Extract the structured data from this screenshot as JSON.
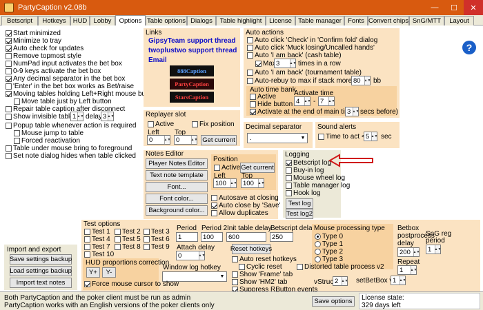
{
  "window": {
    "title": "PartyCaption v2.08b",
    "controls": {
      "minimize": "—",
      "maximize": "☐",
      "close": "✕"
    }
  },
  "tabs": [
    "Betscript",
    "Hotkeys",
    "HUD",
    "Lobby",
    "Options",
    "Table options",
    "Dialogs",
    "Table highlight",
    "License",
    "Table manager",
    "Fonts",
    "Convert chips",
    "SnG/MTT",
    "Layout"
  ],
  "general": {
    "start_minimized": "Start minimized",
    "minimize_tray": "Minimize to tray",
    "auto_check": "Auto check for updates",
    "remove_topmost": "Remove topmost style",
    "numpad": "NumPad input activates the bet box",
    "keys09": "0-9 keys activate the bet box",
    "decimal": "Any decimal separator in the bet box",
    "enter": "'Enter' in the bet box works as Bet/raise",
    "moving": "Moving tables holding Left+Right mouse buttons",
    "move_left": "Move table just by Left button",
    "repair": "Repair table caption after disconnect",
    "show_invisible": "Show invisible tables v",
    "show_invisible_val": "1",
    "delay_lbl": "delay",
    "delay_val": "3",
    "popup": "Popup table whenever action is required",
    "mouse_jump": "Mouse jump to table",
    "forced": "Forced reactivation",
    "under_mouse": "Table under mouse bring to foreground",
    "set_note": "Set note dialog hides when table clicked"
  },
  "links": {
    "title": "Links",
    "gipsy": "GipsyTeam support thread",
    "twoplus": "twoplustwo support thread",
    "email": "Email",
    "btn888": "888Caption",
    "btnparty": "PartyCaption",
    "btnstars": "StarsCaption"
  },
  "replayer": {
    "title": "Replayer slot",
    "active": "Active",
    "fix": "Fix position",
    "left": "Left",
    "top": "Top",
    "left_val": "0",
    "top_val": "0",
    "get": "Get current"
  },
  "auto": {
    "title": "Auto actions",
    "check": "Auto click 'Check' in 'Confirm fold' dialog",
    "muck": "Auto click 'Muck losing/Uncalled hands'",
    "back_cash": "Auto 'I am back' (cash table)",
    "max": "Max",
    "max_val": "3",
    "times": "times in a row",
    "back_tourn": "Auto 'I am back' (tournament table)",
    "rebuy": "Auto-rebuy to max if stack more than",
    "rebuy_val": "80",
    "bb": "bb"
  },
  "timebank": {
    "title": "Auto time bank",
    "active": "Active",
    "hide": "Hide button",
    "act_end": "Activate at the end of main time (",
    "act_end_val": "3",
    "secs": "secs before)",
    "act_time": "Activate time",
    "from": "4",
    "dash": "-",
    "to": "7"
  },
  "decimal": {
    "title": "Decimal separator",
    "value": "."
  },
  "sound": {
    "title": "Sound alerts",
    "time_to_act": "Time to act <",
    "val": "5",
    "sec": "sec"
  },
  "notes": {
    "title": "Notes Editor",
    "player_notes": "Player Notes Editor",
    "text_template": "Text note template",
    "font": "Font...",
    "font_color": "Font color...",
    "bg_color": "Background color..."
  },
  "position": {
    "title": "Position",
    "active": "Active",
    "get": "Get current",
    "left": "Left",
    "top": "Top",
    "left_val": "100",
    "top_val": "100",
    "autosave": "Autosave at closing",
    "autoclose": "Auto close by 'Save'",
    "allow_dup": "Allow duplicates"
  },
  "logging": {
    "title": "Logging",
    "betscript": "Betscript log",
    "buyin": "Buy-in log",
    "mousewheel": "Mouse wheel log",
    "tablemgr": "Table manager log",
    "hook": "Hook log",
    "btn_log": "Test log",
    "btn_log2": "Test log2"
  },
  "test": {
    "title": "Test options",
    "items": [
      "Test 1",
      "Test 2",
      "Test 3",
      "Test 4",
      "Test 5",
      "Test 6",
      "Test 7",
      "Test 8",
      "Test 9",
      "Test 10"
    ],
    "period": "Period",
    "period_val": "1",
    "period2": "Period 2",
    "period2_val": "100",
    "init_delay": "Init table delay",
    "init_delay_val": "600",
    "betscript_delay": "Betscript delay",
    "betscript_delay_val": "250",
    "attach": "Attach delay",
    "attach_val": "0",
    "reset_hotkeys": "Reset hotkeys",
    "auto_reset": "Auto reset hotkeys",
    "cyclic": "Cyclic reset",
    "show_frame": "Show 'Frame' tab",
    "show_hm2": "Show 'HM2' tab",
    "suppress": "Suppress RButton events",
    "window_hotkey": "Window log hotkey",
    "window_hotkey_val": ""
  },
  "mouse": {
    "title": "Mouse processing type",
    "types": [
      "Type 0",
      "Type 1",
      "Type 2",
      "Type 3"
    ],
    "distorted": "Distorted table process v2",
    "vstruct": "vStruct",
    "vstruct_val": "2"
  },
  "betbox": {
    "title1": "Betbox",
    "title2": "postprocess",
    "title3": "delay",
    "delay_val": "200",
    "repeat": "Repeat",
    "repeat_val": "1",
    "setbetbox": "setBetBox v",
    "setbetbox_val": "1",
    "sng_title": "SnG reg",
    "sng_title2": "period",
    "sng_val": "1"
  },
  "hud_corr": {
    "title": "HUD proportions correction",
    "yplus": "Y+",
    "yminus": "Y-",
    "force": "Force mouse cursor to show"
  },
  "import": {
    "title": "Import and export",
    "save": "Save settings backup",
    "load": "Load settings backup",
    "import_notes": "Import text notes"
  },
  "statusbar": {
    "line1": "Both PartyCaption and the poker client must be run as admin",
    "line2": "PartyCaption works with an English versions of the poker clients only",
    "save": "Save options",
    "license": "License state:",
    "days": "329 days left"
  },
  "colors": {
    "title": "#d85a0f",
    "close": "#d0302a",
    "link": "#1010c8",
    "panel": "#fbe3c2",
    "arrow": "#d01a1a"
  }
}
